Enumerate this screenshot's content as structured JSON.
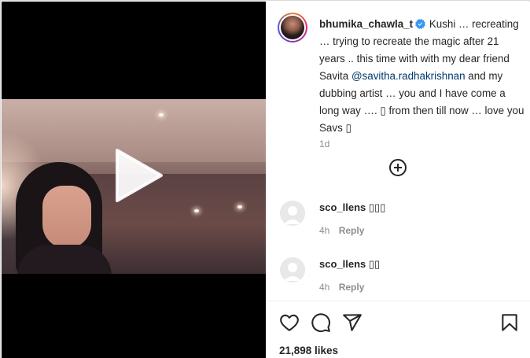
{
  "post": {
    "username": "bhumika_chawla_t",
    "caption": "Kushi … recreating … trying to recreate the magic after 21 years .. this time with with my dear friend Savita",
    "mention": "@savitha.radhakrishnan",
    "caption_end": "and my dubbing artist … you and I have come a long way …. ▯ from then till now … love you Savs ▯",
    "time_ago": "1d",
    "likes": "21,898 likes"
  },
  "comments": [
    {
      "username": "sco_llens",
      "text": "▯▯▯",
      "time": "4h",
      "reply_label": "Reply"
    },
    {
      "username": "sco_llens",
      "text": "▯▯",
      "time": "4h",
      "reply_label": "Reply"
    }
  ],
  "icons": {
    "verified": "verified-badge-icon",
    "more": "plus-circle-icon",
    "like": "heart-icon",
    "comment": "comment-icon",
    "share": "paper-plane-icon",
    "save": "bookmark-icon",
    "play": "play-icon"
  },
  "colors": {
    "text": "#262626",
    "secondary": "#8e8e8e",
    "link": "#00376b",
    "verified": "#3897f0"
  }
}
